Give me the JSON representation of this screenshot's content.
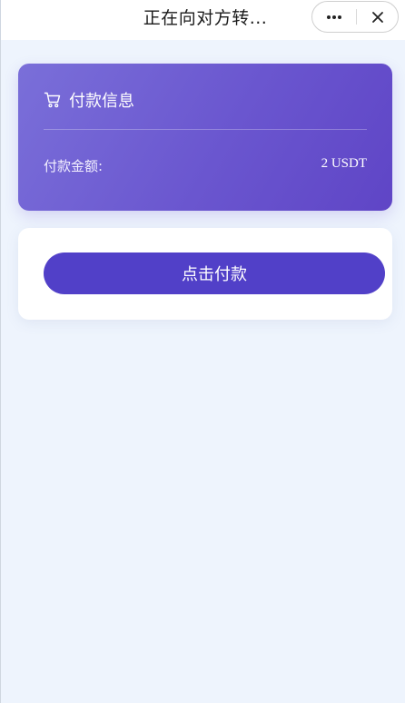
{
  "topbar": {
    "title": "正在向对方转...",
    "more_icon": "more-dots-icon",
    "close_icon": "close-icon"
  },
  "payment_info": {
    "title": "付款信息",
    "icon": "shopping-cart-icon",
    "amount_label": "付款金额:",
    "amount_value": "2 USDT"
  },
  "action": {
    "pay_button_label": "点击付款"
  },
  "colors": {
    "page_background": "#eef4fd",
    "card_gradient_start": "#7a6fd9",
    "card_gradient_end": "#5f45c6",
    "button": "#5140c8"
  }
}
